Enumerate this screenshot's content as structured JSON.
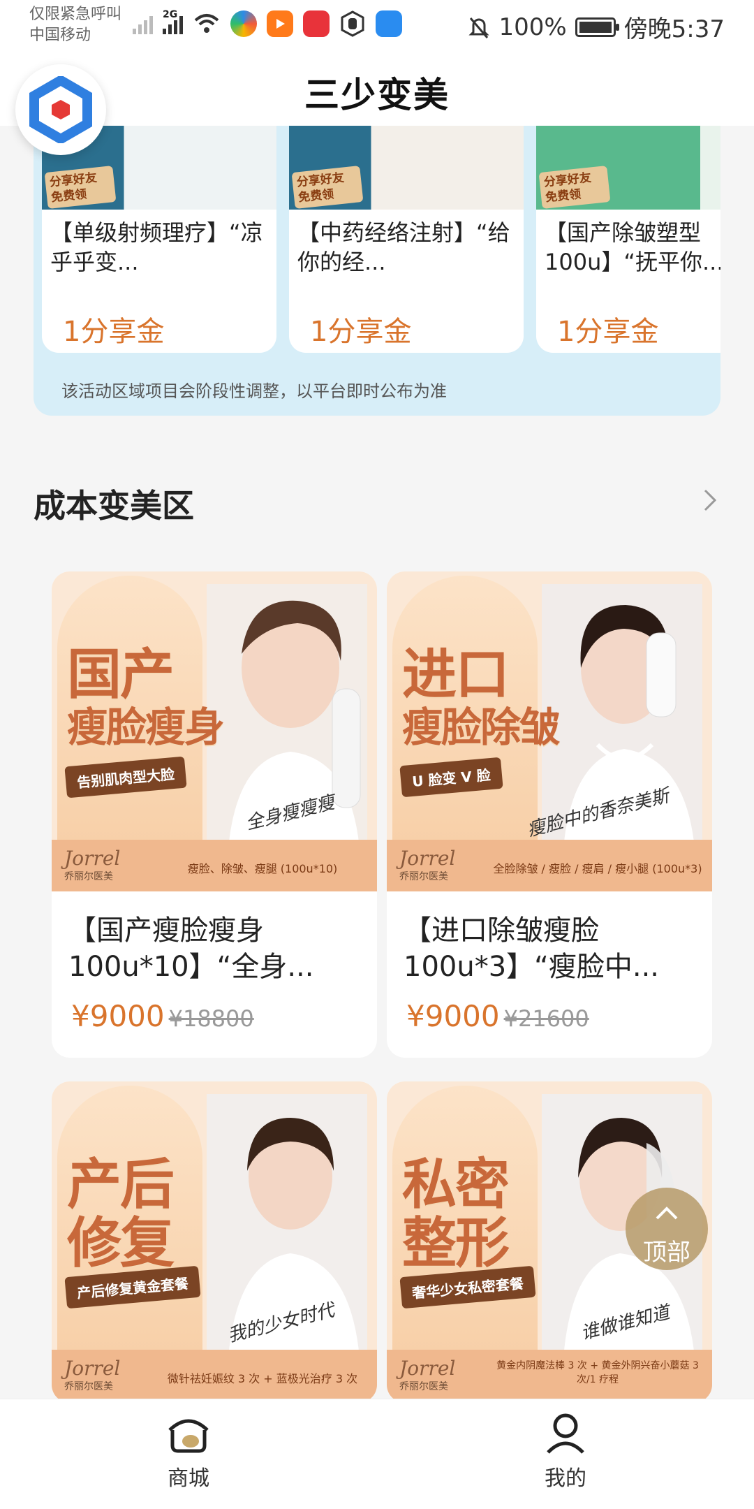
{
  "status_bar": {
    "carrier_line1": "仅限紧急呼叫",
    "carrier_line2": "中国移动",
    "network": "2G",
    "battery": "100%",
    "time": "傍晚5:37"
  },
  "header": {
    "title": "三少变美"
  },
  "activity": {
    "cards": [
      {
        "title": "【单级射频理疗】“凉乎乎变...",
        "price": "1分享金",
        "badge": "分享好友 免费领"
      },
      {
        "title": "【中药经络注射】“给你的经...",
        "price": "1分享金",
        "badge": "分享好友 免费领"
      },
      {
        "title": "【国产除皱塑型100u】“抚平你...",
        "price": "1分享金",
        "badge": "分享好友 免费领"
      }
    ],
    "note": "该活动区域项目会阶段性调整，以平台即时公布为准"
  },
  "section": {
    "title": "成本变美区"
  },
  "products": [
    {
      "promo_main": "国产",
      "promo_sub": "瘦脸瘦身",
      "promo_tag": "告别肌肉型大脸",
      "band_text": "瘦脸、除皱、瘦腿 (100u*10)",
      "script": "全身瘦瘦瘦",
      "brand": "Jorrel",
      "brand_cn": "乔丽尔医美",
      "title": "【国产瘦脸瘦身100u*10】“全身...",
      "price": "¥9000",
      "old_price": "¥18800"
    },
    {
      "promo_main": "进口",
      "promo_sub": "瘦脸除皱",
      "promo_tag": "U 脸变 V 脸",
      "band_text": "全脸除皱 / 瘦脸 / 瘦肩 / 瘦小腿 (100u*3)",
      "script": "瘦脸中的香奈美斯",
      "brand": "Jorrel",
      "brand_cn": "乔丽尔医美",
      "title": "【进口除皱瘦脸100u*3】“瘦脸中...",
      "price": "¥9000",
      "old_price": "¥21600"
    },
    {
      "promo_main": "产后",
      "promo_sub": "修复",
      "promo_tag": "产后修复黄金套餐",
      "band_text": "微针祛妊娠纹 3 次 + 蓝极光治疗 3 次",
      "script": "我的少女时代",
      "brand": "Jorrel",
      "brand_cn": "乔丽尔医美"
    },
    {
      "promo_main": "私密",
      "promo_sub": "整形",
      "promo_tag": "奢华少女私密套餐",
      "band_text": "黄金内阴魔法棒 3 次 + 黄金外阴兴奋小蘑菇 3 次/1 疗程",
      "script": "谁做谁知道",
      "brand": "Jorrel",
      "brand_cn": "乔丽尔医美"
    }
  ],
  "float": {
    "to_top": "顶部"
  },
  "nav": {
    "shop": "商城",
    "mine": "我的"
  },
  "colors": {
    "accent": "#d9742c",
    "activity_bg": "#d7eef8",
    "to_top": "#b69a68"
  }
}
